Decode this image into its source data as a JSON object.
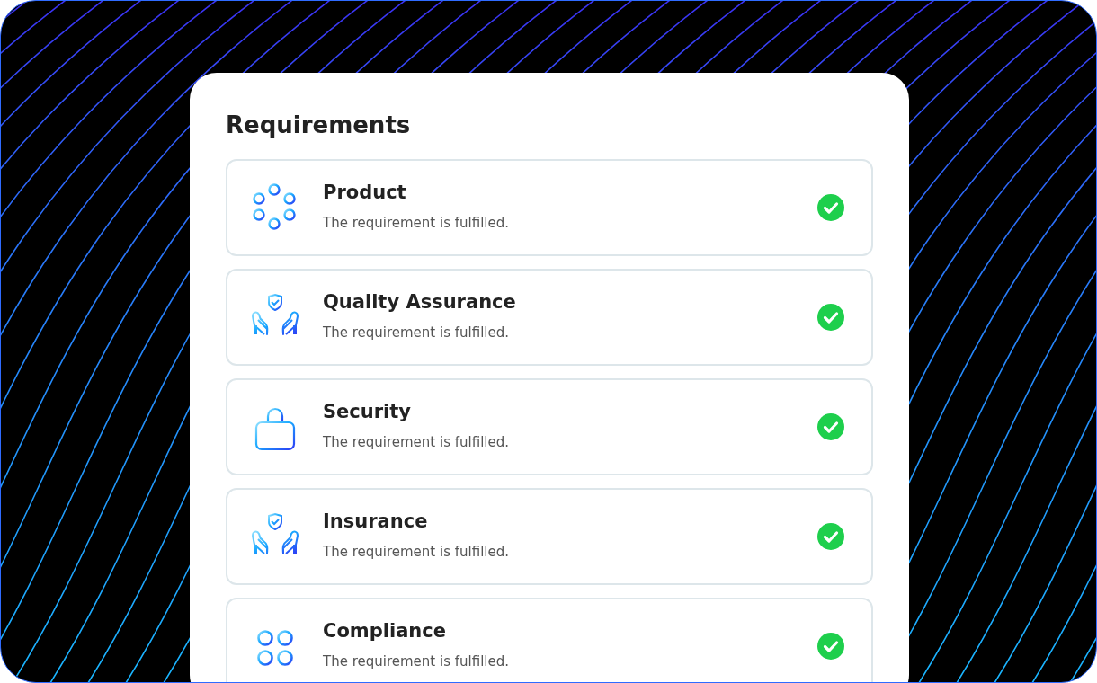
{
  "title": "Requirements",
  "requirements": [
    {
      "kind": "dots",
      "name": "Product",
      "description": "The requirement is fulfilled.",
      "fulfilled": true
    },
    {
      "kind": "hands",
      "name": "Quality Assurance",
      "description": "The requirement is fulfilled.",
      "fulfilled": true
    },
    {
      "kind": "lock",
      "name": "Security",
      "description": "The requirement is fulfilled.",
      "fulfilled": true
    },
    {
      "kind": "hands",
      "name": "Insurance",
      "description": "The requirement is fulfilled.",
      "fulfilled": true
    },
    {
      "kind": "grid",
      "name": "Compliance",
      "description": "The requirement is fulfilled.",
      "fulfilled": true
    }
  ]
}
